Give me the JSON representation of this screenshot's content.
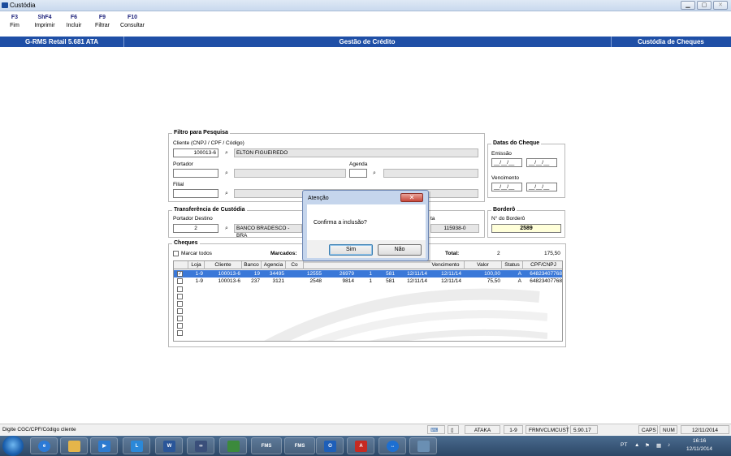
{
  "window": {
    "title": "Custódia"
  },
  "fkeys": [
    {
      "key": "F3",
      "label": "Fim"
    },
    {
      "key": "ShF4",
      "label": "Imprimir"
    },
    {
      "key": "F6",
      "label": "Incluir"
    },
    {
      "key": "F9",
      "label": "Filtrar"
    },
    {
      "key": "F10",
      "label": "Consultar"
    }
  ],
  "header": {
    "left": "G-RMS Retail 5.681 ATA",
    "center": "Gestão de Crédito",
    "right": "Custódia de Cheques"
  },
  "filtro": {
    "legend": "Filtro para Pesquisa",
    "cliente_label": "Cliente (CNPJ / CPF / Código)",
    "cliente_code": "100013-6",
    "cliente_name": "ELTON FIGUEIREDO",
    "portador_label": "Portador",
    "agenda_label": "Agenda",
    "filial_label": "Filial"
  },
  "datas": {
    "legend": "Datas do Cheque",
    "emissao_label": "Emissão",
    "vencimento_label": "Vencimento",
    "date_mask": "__/__/__"
  },
  "transferencia": {
    "legend": "Transferência de Custódia",
    "portador_label": "Portador Destino",
    "portador_code": "2",
    "portador_name": "BANCO BRADESCO - BRA",
    "conta_label": "ta",
    "conta_value": "115938-0"
  },
  "bordero": {
    "legend": "Borderô",
    "label": "N° do Borderô",
    "value": "2589"
  },
  "cheques": {
    "legend": "Cheques",
    "marcar_todos": "Marcar todos",
    "marcados_label": "Marcados:",
    "total_label": "Total:",
    "total_count": "2",
    "total_value": "175,50",
    "columns": [
      "Loja",
      "Cliente",
      "Banco",
      "Agencia",
      "Co",
      "Vencimento",
      "Valor",
      "Status",
      "CPF/CNPJ"
    ],
    "rows": [
      {
        "checked": true,
        "loja": "1-9",
        "cliente": "100013-6",
        "banco": "19",
        "agencia": "34495",
        "conta": "12555",
        "cheque": "26979",
        "x1": "1",
        "x2": "581",
        "emissao": "12/11/14",
        "vencimento": "12/11/14",
        "valor": "100,00",
        "status": "A",
        "cpf": "64823407768"
      },
      {
        "checked": false,
        "loja": "1-9",
        "cliente": "100013-6",
        "banco": "237",
        "agencia": "3121",
        "conta": "2548",
        "cheque": "9814",
        "x1": "1",
        "x2": "581",
        "emissao": "12/11/14",
        "vencimento": "12/11/14",
        "valor": "75,50",
        "status": "A",
        "cpf": "64823407768"
      }
    ]
  },
  "dialog": {
    "title": "Atenção",
    "message": "Confirma a inclusão?",
    "yes": "Sim",
    "no": "Não"
  },
  "statusbar": {
    "hint": "Digite CGC/CPF/Código cliente",
    "user": "ATAKA",
    "store": "1-9",
    "program": "FRMVCLMCUST",
    "version": "5.90.17",
    "caps": "CAPS",
    "num": "NUM",
    "date": "12/11/2014"
  },
  "taskbar": {
    "apps": [
      "ie",
      "explorer",
      "media",
      "lync",
      "word",
      "app",
      "excel-green",
      "fms",
      "fms",
      "outlook",
      "acrobat",
      "teamviewer",
      "app2"
    ],
    "lang": "PT",
    "time": "16:16",
    "date": "12/11/2014"
  }
}
